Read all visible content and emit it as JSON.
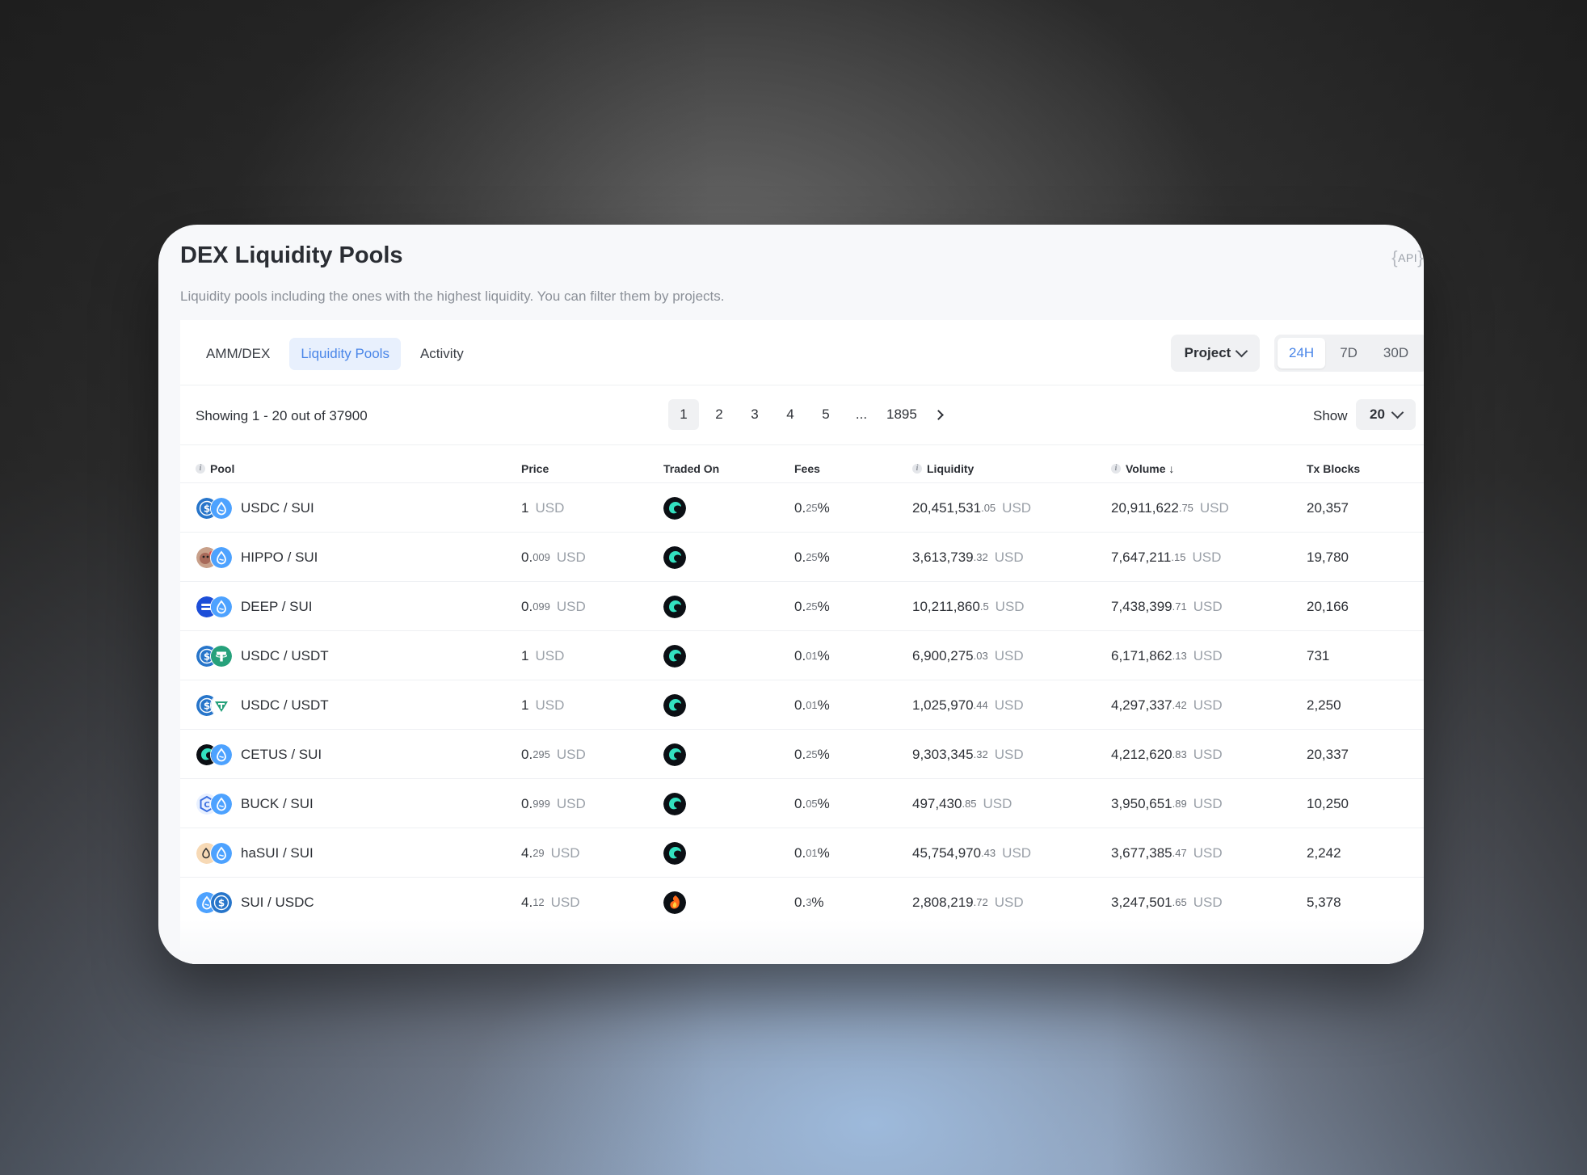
{
  "header": {
    "title": "DEX Liquidity Pools",
    "api_label": "API",
    "subtitle": "Liquidity pools including the ones with the highest liquidity. You can filter them by projects."
  },
  "tabs": [
    {
      "label": "AMM/DEX",
      "active": false
    },
    {
      "label": "Liquidity Pools",
      "active": true
    },
    {
      "label": "Activity",
      "active": false
    }
  ],
  "filters": {
    "project_label": "Project",
    "ranges": [
      {
        "label": "24H",
        "active": true
      },
      {
        "label": "7D",
        "active": false
      },
      {
        "label": "30D",
        "active": false
      }
    ]
  },
  "pagination": {
    "showing": "Showing 1 - 20 out of 37900",
    "pages": [
      "1",
      "2",
      "3",
      "4",
      "5",
      "...",
      "1895"
    ],
    "current": "1",
    "show_label": "Show",
    "page_size": "20"
  },
  "columns": {
    "pool": "Pool",
    "price": "Price",
    "traded_on": "Traded On",
    "fees": "Fees",
    "liquidity": "Liquidity",
    "volume": "Volume ↓",
    "tx_blocks": "Tx Blocks"
  },
  "rows": [
    {
      "pair": "USDC / SUI",
      "icons": [
        "usdc-icon",
        "sui-icon"
      ],
      "price_main": "1",
      "price_dec": "",
      "unit": "USD",
      "dex": "cetus-icon",
      "fee_main": "0.",
      "fee_dec": "25",
      "fee_pct": "%",
      "liq_main": "20,451,531",
      "liq_dec": ".05",
      "vol_main": "20,911,622",
      "vol_dec": ".75",
      "tx": "20,357"
    },
    {
      "pair": "HIPPO / SUI",
      "icons": [
        "hippo-icon",
        "sui-icon"
      ],
      "price_main": "0.",
      "price_dec": "009",
      "unit": "USD",
      "dex": "cetus-icon",
      "fee_main": "0.",
      "fee_dec": "25",
      "fee_pct": "%",
      "liq_main": "3,613,739",
      "liq_dec": ".32",
      "vol_main": "7,647,211",
      "vol_dec": ".15",
      "tx": "19,780"
    },
    {
      "pair": "DEEP / SUI",
      "icons": [
        "deep-icon",
        "sui-icon"
      ],
      "price_main": "0.",
      "price_dec": "099",
      "unit": "USD",
      "dex": "cetus-icon",
      "fee_main": "0.",
      "fee_dec": "25",
      "fee_pct": "%",
      "liq_main": "10,211,860",
      "liq_dec": ".5",
      "vol_main": "7,438,399",
      "vol_dec": ".71",
      "tx": "20,166"
    },
    {
      "pair": "USDC / USDT",
      "icons": [
        "usdc-icon",
        "usdt-icon"
      ],
      "price_main": "1",
      "price_dec": "",
      "unit": "USD",
      "dex": "cetus-icon",
      "fee_main": "0.",
      "fee_dec": "01",
      "fee_pct": "%",
      "liq_main": "6,900,275",
      "liq_dec": ".03",
      "vol_main": "6,171,862",
      "vol_dec": ".13",
      "tx": "731"
    },
    {
      "pair": "USDC / USDT",
      "icons": [
        "usdc-icon",
        "usdt-wormhole-icon"
      ],
      "price_main": "1",
      "price_dec": "",
      "unit": "USD",
      "dex": "cetus-icon",
      "fee_main": "0.",
      "fee_dec": "01",
      "fee_pct": "%",
      "liq_main": "1,025,970",
      "liq_dec": ".44",
      "vol_main": "4,297,337",
      "vol_dec": ".42",
      "tx": "2,250"
    },
    {
      "pair": "CETUS / SUI",
      "icons": [
        "cetus-token-icon",
        "sui-icon"
      ],
      "price_main": "0.",
      "price_dec": "295",
      "unit": "USD",
      "dex": "cetus-icon",
      "fee_main": "0.",
      "fee_dec": "25",
      "fee_pct": "%",
      "liq_main": "9,303,345",
      "liq_dec": ".32",
      "vol_main": "4,212,620",
      "vol_dec": ".83",
      "tx": "20,337"
    },
    {
      "pair": "BUCK / SUI",
      "icons": [
        "buck-icon",
        "sui-icon"
      ],
      "price_main": "0.",
      "price_dec": "999",
      "unit": "USD",
      "dex": "cetus-icon",
      "fee_main": "0.",
      "fee_dec": "05",
      "fee_pct": "%",
      "liq_main": "497,430",
      "liq_dec": ".85",
      "vol_main": "3,950,651",
      "vol_dec": ".89",
      "tx": "10,250"
    },
    {
      "pair": "haSUI / SUI",
      "icons": [
        "hasui-icon",
        "sui-icon"
      ],
      "price_main": "4.",
      "price_dec": "29",
      "unit": "USD",
      "dex": "cetus-icon",
      "fee_main": "0.",
      "fee_dec": "01",
      "fee_pct": "%",
      "liq_main": "45,754,970",
      "liq_dec": ".43",
      "vol_main": "3,677,385",
      "vol_dec": ".47",
      "tx": "2,242"
    },
    {
      "pair": "SUI / USDC",
      "icons": [
        "sui-icon",
        "usdc-icon"
      ],
      "price_main": "4.",
      "price_dec": "12",
      "unit": "USD",
      "dex": "turbos-icon",
      "fee_main": "0.",
      "fee_dec": "3",
      "fee_pct": "%",
      "liq_main": "2,808,219",
      "liq_dec": ".72",
      "vol_main": "3,247,501",
      "vol_dec": ".65",
      "tx": "5,378"
    }
  ],
  "colors": {
    "accent": "#4a86e8",
    "sui": "#4da2ff",
    "usdc": "#2775ca",
    "usdt": "#26a17b",
    "deep": "#1d4ed8",
    "cetus_dark": "#0b0f14",
    "cetus_teal": "#33e1c0"
  }
}
